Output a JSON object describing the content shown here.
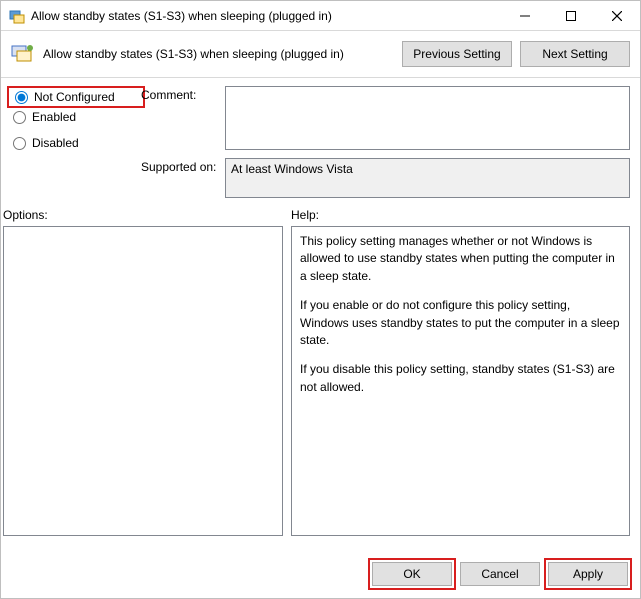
{
  "window": {
    "title": "Allow standby states (S1-S3) when sleeping (plugged in)"
  },
  "header": {
    "title": "Allow standby states (S1-S3) when sleeping (plugged in)",
    "previous": "Previous Setting",
    "next": "Next Setting"
  },
  "radios": {
    "not_configured": "Not Configured",
    "enabled": "Enabled",
    "disabled": "Disabled",
    "selected": "not_configured"
  },
  "fields": {
    "comment_label": "Comment:",
    "comment_value": "",
    "supported_label": "Supported on:",
    "supported_value": "At least Windows Vista"
  },
  "lower": {
    "options_label": "Options:",
    "help_label": "Help:",
    "help_p1": "This policy setting manages whether or not Windows is allowed to use standby states when putting the computer in a sleep state.",
    "help_p2": "If you enable or do not configure this policy setting, Windows uses standby states to put the computer in a sleep state.",
    "help_p3": "If you disable this policy setting, standby states (S1-S3) are not allowed."
  },
  "footer": {
    "ok": "OK",
    "cancel": "Cancel",
    "apply": "Apply"
  }
}
